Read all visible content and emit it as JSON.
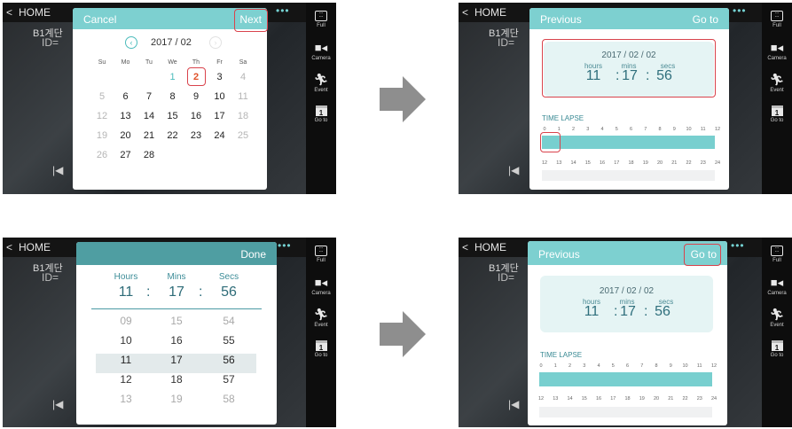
{
  "common": {
    "home_label": "HOME",
    "back_glyph": "<",
    "more_glyph": "•••",
    "skip_glyph": "|◀",
    "camera_label": "B1계단",
    "camera_id": "ID=",
    "right_menu": [
      {
        "label": "Full",
        "icon": "fullscreen-icon"
      },
      {
        "label": "Camera",
        "icon": "camera-icon"
      },
      {
        "label": "Event",
        "icon": "running-person-icon"
      },
      {
        "label": "Go to",
        "icon": "calendar-icon",
        "glyph": "1"
      }
    ]
  },
  "step1": {
    "cancel": "Cancel",
    "next": "Next",
    "month": "2017 / 02",
    "weekdays": [
      "Su",
      "Mo",
      "Tu",
      "We",
      "Th",
      "Fr",
      "Sa"
    ],
    "weeks": [
      [
        "",
        "",
        "",
        "1",
        "2",
        "3",
        "4"
      ],
      [
        "5",
        "6",
        "7",
        "8",
        "9",
        "10",
        "11"
      ],
      [
        "12",
        "13",
        "14",
        "15",
        "16",
        "17",
        "18"
      ],
      [
        "19",
        "20",
        "21",
        "22",
        "23",
        "24",
        "25"
      ],
      [
        "26",
        "27",
        "28",
        "",
        "",
        "",
        ""
      ]
    ],
    "selected_day": "2"
  },
  "step2": {
    "previous": "Previous",
    "goto": "Go to",
    "date": "2017 / 02 / 02",
    "labels": {
      "hours": "hours",
      "mins": "mins",
      "secs": "secs"
    },
    "hours": "11",
    "mins": "17",
    "secs": "56",
    "colon": ":",
    "timelapse": "TIME LAPSE",
    "ticks_top": [
      "0",
      "1",
      "2",
      "3",
      "4",
      "5",
      "6",
      "7",
      "8",
      "9",
      "10",
      "11",
      "12"
    ],
    "ticks_bottom": [
      "12",
      "13",
      "14",
      "15",
      "16",
      "17",
      "18",
      "19",
      "20",
      "21",
      "22",
      "23",
      "24"
    ]
  },
  "step3": {
    "done": "Done",
    "labels": {
      "hours": "Hours",
      "mins": "Mins",
      "secs": "Secs"
    },
    "hours": "11",
    "mins": "17",
    "secs": "56",
    "colon": ":",
    "rows": [
      {
        "h": "09",
        "m": "15",
        "s": "54"
      },
      {
        "h": "10",
        "m": "16",
        "s": "55"
      },
      {
        "h": "11",
        "m": "17",
        "s": "56"
      },
      {
        "h": "12",
        "m": "18",
        "s": "57"
      },
      {
        "h": "13",
        "m": "19",
        "s": "58"
      }
    ]
  },
  "step4": {
    "previous": "Previous",
    "goto": "Go to",
    "date": "2017 / 02 / 02",
    "labels": {
      "hours": "hours",
      "mins": "mins",
      "secs": "secs"
    },
    "hours": "11",
    "mins": "17",
    "secs": "56",
    "colon": ":",
    "timelapse": "TIME LAPSE",
    "ticks_top": [
      "0",
      "1",
      "2",
      "3",
      "4",
      "5",
      "6",
      "7",
      "8",
      "9",
      "10",
      "11",
      "12"
    ],
    "ticks_bottom": [
      "12",
      "13",
      "14",
      "15",
      "16",
      "17",
      "18",
      "19",
      "20",
      "21",
      "22",
      "23",
      "24"
    ]
  },
  "colors": {
    "accent": "#7dd0d0",
    "highlight_box": "#d9434c",
    "selected_day": "#e0522a"
  }
}
